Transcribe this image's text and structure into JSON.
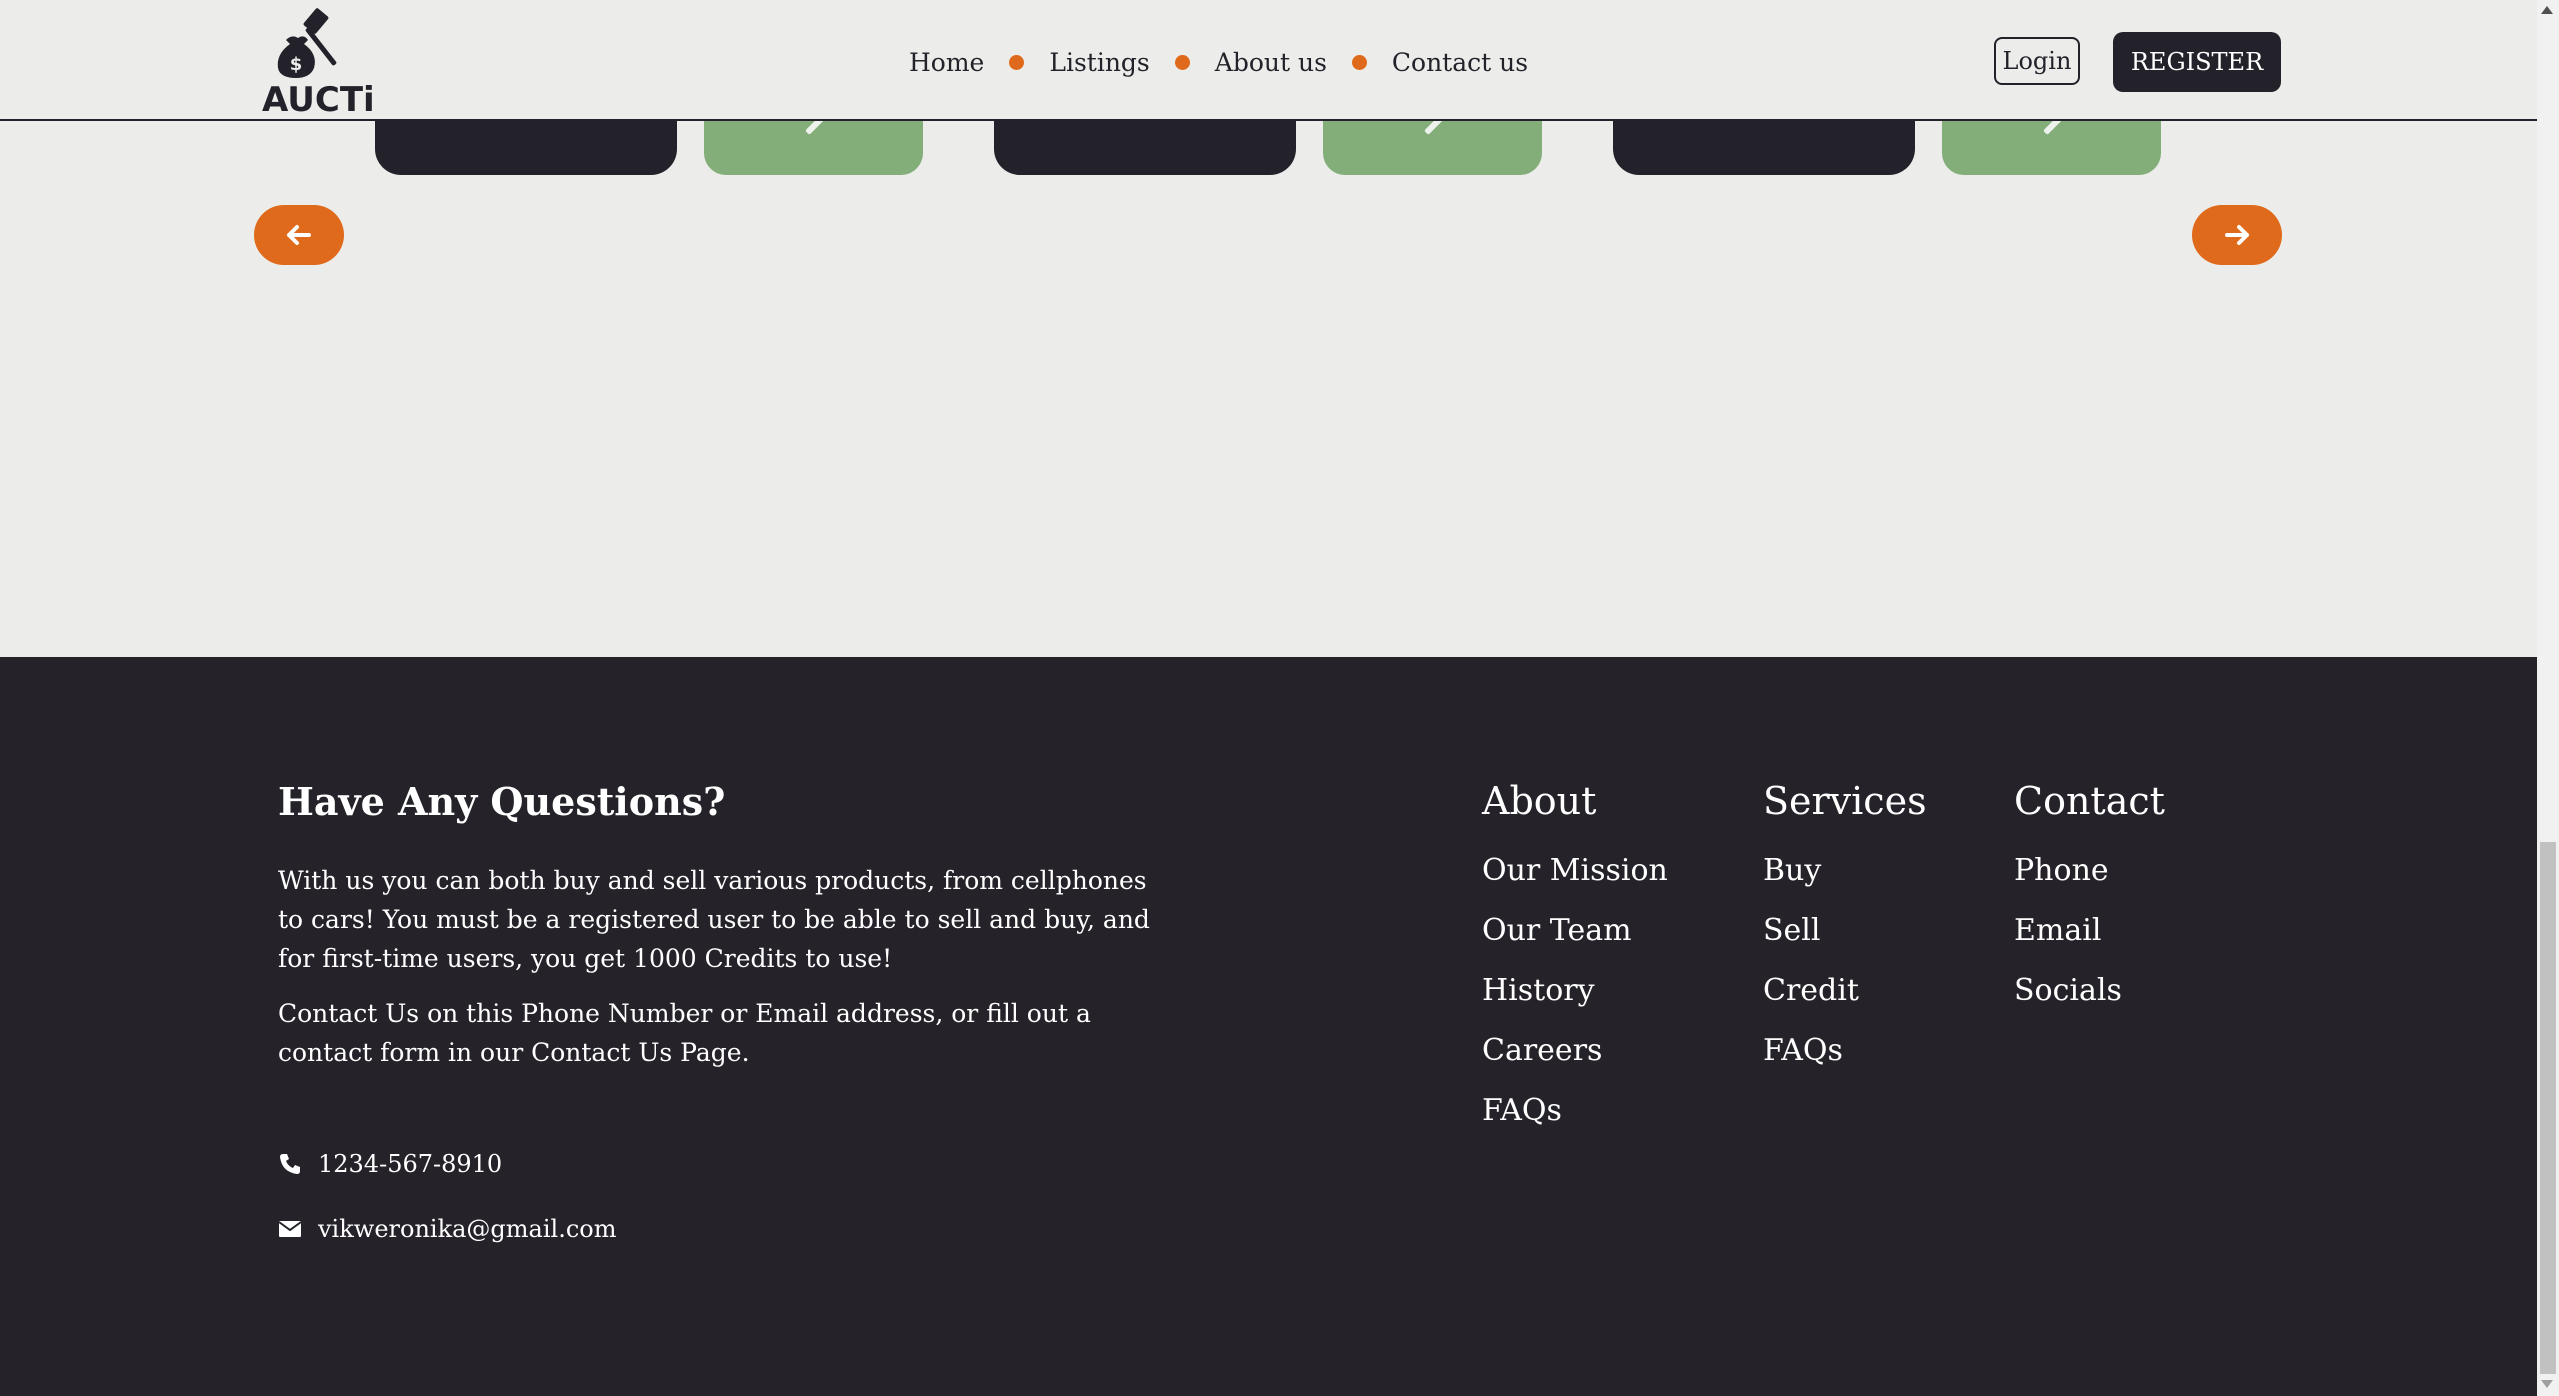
{
  "header": {
    "logo_text": "AUCTi",
    "nav": [
      "Home",
      "Listings",
      "About us",
      "Contact us"
    ],
    "login_label": "Login",
    "register_label": "REGISTER"
  },
  "carousel": {
    "prev_icon": "arrow-left-icon",
    "next_icon": "arrow-right-icon"
  },
  "footer": {
    "heading": "Have Any Questions?",
    "para1": "With us you can both buy and sell various products, from cellphones to cars! You must be a registered user to be able to sell and buy, and for first-time users, you get 1000 Credits to use!",
    "para2": "Contact Us on this Phone Number or Email address, or fill out a contact form in our Contact Us Page.",
    "phone": "1234-567-8910",
    "email": "vikweronika@gmail.com",
    "columns": [
      {
        "title": "About",
        "links": [
          "Our Mission",
          "Our Team",
          "History",
          "Careers",
          "FAQs"
        ]
      },
      {
        "title": "Services",
        "links": [
          "Buy",
          "Sell",
          "Credit",
          "FAQs"
        ]
      },
      {
        "title": "Contact",
        "links": [
          "Phone",
          "Email",
          "Socials"
        ]
      }
    ]
  },
  "colors": {
    "accent": "#df6a1b",
    "dark": "#23222a",
    "green": "#83ad79",
    "background": "#ecedea"
  }
}
